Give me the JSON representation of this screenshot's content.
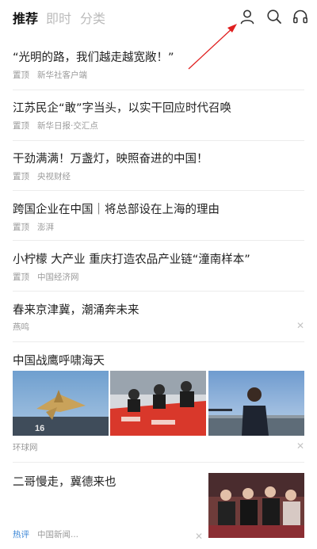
{
  "header": {
    "tabs": [
      {
        "label": "推荐"
      },
      {
        "label": "即时"
      },
      {
        "label": "分类"
      }
    ],
    "icons": {
      "user": "user-icon",
      "search": "search-icon",
      "audio": "headphones-icon"
    }
  },
  "feed": [
    {
      "title": "“光明的路，我们越走越宽敞！”",
      "tag": "置顶",
      "source": "新华社客户端"
    },
    {
      "title": "江苏民企“敢”字当头，以实干回应时代召唤",
      "tag": "置顶",
      "source": "新华日报·交汇点"
    },
    {
      "title": "干劲满满！万盏灯，映照奋进的中国！",
      "tag": "置顶",
      "source": "央视财经"
    },
    {
      "title": "跨国企业在中国｜将总部设在上海的理由",
      "tag": "置顶",
      "source": "澎湃"
    },
    {
      "title": "小柠檬 大产业 重庆打造农品产业链“潼南样本”",
      "tag": "置顶",
      "source": "中国经济网"
    },
    {
      "title": "春来京津冀，潮涌奔未来",
      "source": "燕鸣"
    },
    {
      "title": "中国战鹰呼啸海天",
      "source": "环球网"
    },
    {
      "title": "二哥慢走，冀德来也",
      "tag": "热评",
      "source": "中国新闻..."
    }
  ],
  "colors": {
    "hot_tag": "#3a86d6",
    "annotation_arrow": "#e02020"
  }
}
